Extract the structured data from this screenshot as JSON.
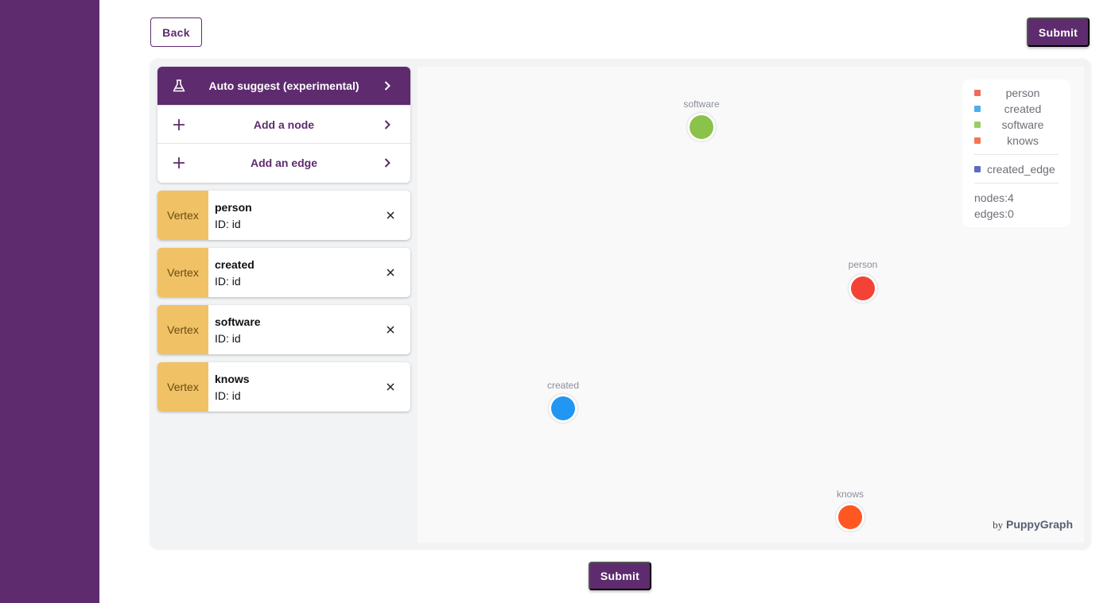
{
  "header": {
    "back_label": "Back",
    "submit_label": "Submit"
  },
  "footer": {
    "submit_label": "Submit"
  },
  "menu": {
    "items": [
      {
        "label": "Auto suggest (experimental)",
        "icon": "flask-icon"
      },
      {
        "label": "Add a node",
        "icon": "plus-icon"
      },
      {
        "label": "Add an edge",
        "icon": "plus-icon"
      }
    ]
  },
  "vertices": [
    {
      "tag": "Vertex",
      "name": "person",
      "id": "ID: id"
    },
    {
      "tag": "Vertex",
      "name": "created",
      "id": "ID: id"
    },
    {
      "tag": "Vertex",
      "name": "software",
      "id": "ID: id"
    },
    {
      "tag": "Vertex",
      "name": "knows",
      "id": "ID: id"
    }
  ],
  "graph": {
    "nodes": [
      {
        "label": "software",
        "color": "#8bc34a"
      },
      {
        "label": "person",
        "color": "#f44336"
      },
      {
        "label": "created",
        "color": "#2196f3"
      },
      {
        "label": "knows",
        "color": "#ff5722"
      }
    ],
    "legend": {
      "node_types": [
        {
          "label": "person",
          "color": "#ef6b5e"
        },
        {
          "label": "created",
          "color": "#4eaee8"
        },
        {
          "label": "software",
          "color": "#9ccc65"
        },
        {
          "label": "knows",
          "color": "#f47551"
        }
      ],
      "edge_types": [
        {
          "label": "created_edge",
          "color": "#5c6bc0"
        }
      ],
      "nodes_count": "nodes:4",
      "edges_count": "edges:0"
    },
    "byline": {
      "by": "by",
      "brand": "PuppyGraph"
    }
  },
  "colors": {
    "brand": "#5e2b6f",
    "vertex_tag": "#f0c265"
  }
}
